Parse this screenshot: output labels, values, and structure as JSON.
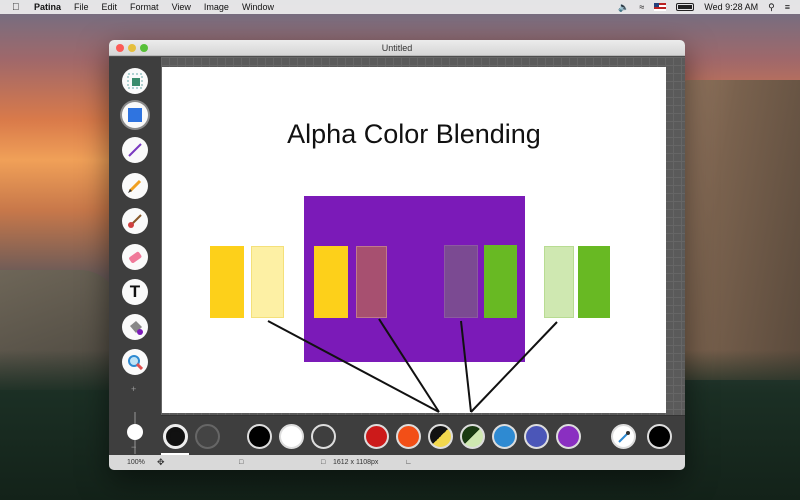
{
  "menubar": {
    "app_name": "Patina",
    "items": [
      "File",
      "Edit",
      "Format",
      "View",
      "Image",
      "Window"
    ],
    "clock": "Wed 9:28 AM"
  },
  "window": {
    "title": "Untitled"
  },
  "toolbar": {
    "tools": [
      {
        "name": "select",
        "icon": "selection-icon"
      },
      {
        "name": "shape",
        "icon": "rectangle-shape-icon",
        "active": true
      },
      {
        "name": "line",
        "icon": "line-icon"
      },
      {
        "name": "pencil",
        "icon": "pencil-icon"
      },
      {
        "name": "brush",
        "icon": "brush-icon"
      },
      {
        "name": "eraser",
        "icon": "eraser-icon"
      },
      {
        "name": "text",
        "icon": "text-tool-icon",
        "glyph": "T"
      },
      {
        "name": "fill",
        "icon": "paint-bucket-icon"
      },
      {
        "name": "zoom",
        "icon": "magnifier-icon"
      }
    ],
    "size_plus": "+",
    "size_minus": "−"
  },
  "canvas": {
    "title": "Alpha Color Blending",
    "colors": {
      "purple": "#7b1ab8",
      "yellow": "#fdd01a",
      "yellow_light": "#fdf0a4",
      "pink_blend": "#a75070",
      "purple_blend": "#7b4a92",
      "green": "#68b923",
      "green_light": "#cfe8b1"
    }
  },
  "palette": {
    "swatches": [
      {
        "name": "black",
        "color": "#000000"
      },
      {
        "name": "white",
        "color": "#ffffff"
      },
      {
        "name": "transparent",
        "color": "transparent"
      },
      {
        "name": "red",
        "color": "#cc1a1a"
      },
      {
        "name": "orange",
        "color": "#f24f17"
      },
      {
        "name": "yellow-split",
        "color": "#f2d84e"
      },
      {
        "name": "green-split",
        "color": "#4da62c"
      },
      {
        "name": "blue",
        "color": "#2e8ad2"
      },
      {
        "name": "indigo",
        "color": "#4b56b8"
      },
      {
        "name": "violet",
        "color": "#8a2fc1"
      }
    ],
    "current_color": "#000000"
  },
  "statusbar": {
    "zoom": "100%",
    "size": "1612 x 1108px"
  }
}
